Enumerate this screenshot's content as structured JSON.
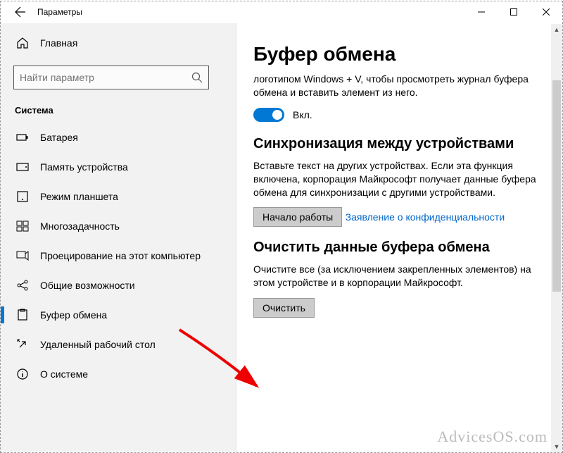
{
  "window": {
    "title": "Параметры"
  },
  "search": {
    "placeholder": "Найти параметр"
  },
  "sidebar": {
    "home": "Главная",
    "section": "Система",
    "items": [
      {
        "label": "Батарея",
        "active": false
      },
      {
        "label": "Память устройства",
        "active": false
      },
      {
        "label": "Режим планшета",
        "active": false
      },
      {
        "label": "Многозадачность",
        "active": false
      },
      {
        "label": "Проецирование на этот компьютер",
        "active": false
      },
      {
        "label": "Общие возможности",
        "active": false
      },
      {
        "label": "Буфер обмена",
        "active": true
      },
      {
        "label": "Удаленный рабочий стол",
        "active": false
      },
      {
        "label": "О системе",
        "active": false
      }
    ]
  },
  "main": {
    "title": "Буфер обмена",
    "history_desc": "логотипом Windows + V, чтобы просмотреть журнал буфера обмена и вставить элемент из него.",
    "toggle_label": "Вкл.",
    "sync_title": "Синхронизация между устройствами",
    "sync_desc": "Вставьте текст на других устройствах. Если эта функция включена, корпорация Майкрософт получает данные буфера обмена для синхронизации с другими устройствами.",
    "sync_button": "Начало работы",
    "privacy_link": "Заявление о конфиденциальности",
    "clear_title": "Очистить данные буфера обмена",
    "clear_desc": "Очистите все (за исключением закрепленных элементов) на этом устройстве и в корпорации Майкрософт.",
    "clear_button": "Очистить"
  },
  "watermark": "AdvicesOS.com"
}
